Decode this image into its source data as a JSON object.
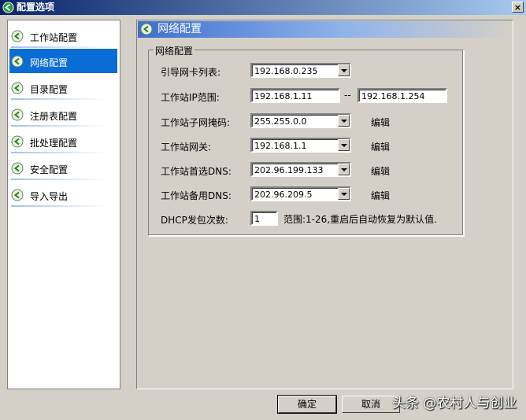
{
  "window": {
    "title": "配置选项",
    "close_glyph": "×"
  },
  "sidebar": {
    "items": [
      {
        "label": "工作站配置"
      },
      {
        "label": "网络配置"
      },
      {
        "label": "目录配置"
      },
      {
        "label": "注册表配置"
      },
      {
        "label": "批处理配置"
      },
      {
        "label": "安全配置"
      },
      {
        "label": "导入导出"
      }
    ],
    "active": "网络配置"
  },
  "panel": {
    "header": "网络配置",
    "group_title": "网络配置",
    "fields": {
      "nic_list": {
        "label": "引导网卡列表:",
        "value": "192.168.0.235"
      },
      "ip_range": {
        "label": "工作站IP范围:",
        "start": "192.168.1.11",
        "separator": "--",
        "end": "192.168.1.254"
      },
      "subnet": {
        "label": "工作站子网掩码:",
        "value": "255.255.0.0",
        "edit": "编辑"
      },
      "gateway": {
        "label": "工作站网关:",
        "value": "192.168.1.1",
        "edit": "编辑"
      },
      "dns1": {
        "label": "工作站首选DNS:",
        "value": "202.96.199.133",
        "edit": "编辑"
      },
      "dns2": {
        "label": "工作站备用DNS:",
        "value": "202.96.209.5",
        "edit": "编辑"
      },
      "dhcp": {
        "label": "DHCP发包次数:",
        "value": "1",
        "hint": "范围:1-26,重启后自动恢复为默认值."
      }
    }
  },
  "buttons": {
    "ok": "确定",
    "cancel": "取消"
  },
  "watermark": "头条 @农村人与创业"
}
